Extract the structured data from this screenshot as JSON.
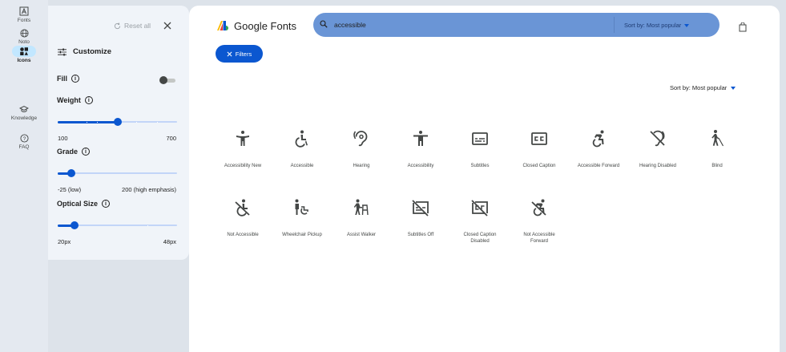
{
  "rail": {
    "items": [
      {
        "label": "Fonts",
        "icon": "font-icon"
      },
      {
        "label": "Noto",
        "icon": "globe-icon"
      },
      {
        "label": "Icons",
        "icon": "shapes-icon"
      },
      {
        "label": "Knowledge",
        "icon": "school-icon"
      },
      {
        "label": "FAQ",
        "icon": "help-icon"
      }
    ]
  },
  "panel": {
    "reset_label": "Reset all",
    "title": "Customize",
    "fill_label": "Fill",
    "weight": {
      "label": "Weight",
      "min_label": "100",
      "max_label": "700",
      "value": 400,
      "min": 100,
      "max": 700
    },
    "grade": {
      "label": "Grade",
      "min_label": "-25 (low)",
      "max_label": "200 (high emphasis)",
      "value": 0,
      "min": -25,
      "max": 200
    },
    "optical": {
      "label": "Optical Size",
      "min_label": "20px",
      "max_label": "48px",
      "value": 24,
      "min": 20,
      "max": 48
    }
  },
  "header": {
    "logo_text": "Google Fonts",
    "search_value": "accessible",
    "search_sort": "Sort by: Most popular",
    "filters_label": "Filters"
  },
  "sort_label": "Sort by: Most popular",
  "colors": {
    "accent": "#0b57d0",
    "search_bg": "#6a95d6",
    "panel_bg": "#f0f4f9"
  },
  "icons": [
    {
      "label": "Accessibility New",
      "icon": "accessibility-new-icon"
    },
    {
      "label": "Accessible",
      "icon": "accessible-icon"
    },
    {
      "label": "Hearing",
      "icon": "hearing-icon"
    },
    {
      "label": "Accessibility",
      "icon": "accessibility-icon"
    },
    {
      "label": "Subtitles",
      "icon": "subtitles-icon"
    },
    {
      "label": "Closed Caption",
      "icon": "closed-caption-icon"
    },
    {
      "label": "Accessible Forward",
      "icon": "accessible-forward-icon"
    },
    {
      "label": "Hearing Disabled",
      "icon": "hearing-disabled-icon"
    },
    {
      "label": "Blind",
      "icon": "blind-icon"
    },
    {
      "label": "Not Accessible",
      "icon": "not-accessible-icon"
    },
    {
      "label": "Wheelchair Pickup",
      "icon": "wheelchair-pickup-icon"
    },
    {
      "label": "Assist Walker",
      "icon": "assist-walker-icon"
    },
    {
      "label": "Subtitles Off",
      "icon": "subtitles-off-icon"
    },
    {
      "label": "Closed Caption Disabled",
      "icon": "closed-caption-disabled-icon"
    },
    {
      "label": "Not Accessible Forward",
      "icon": "not-accessible-forward-icon"
    }
  ]
}
